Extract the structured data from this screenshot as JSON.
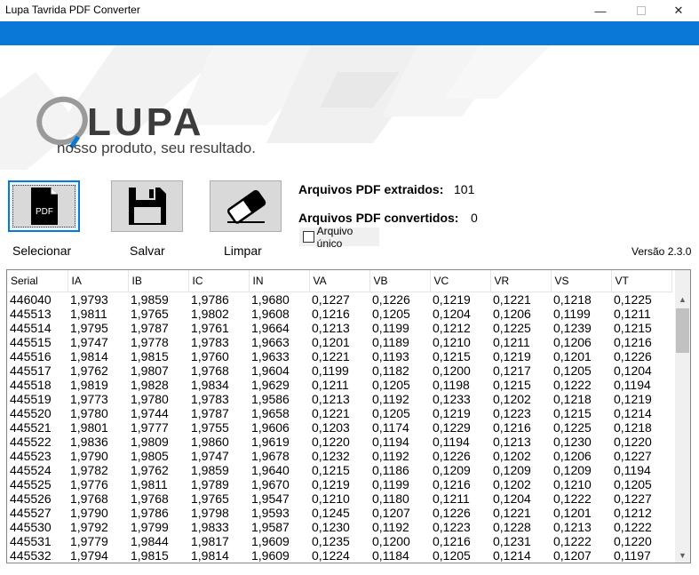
{
  "window": {
    "title": "Lupa Tavrida PDF Converter",
    "minimize_glyph": "—",
    "close_glyph": "✕"
  },
  "banner": {
    "logo_text": "LUPA",
    "tagline": "nosso produto, seu resultado."
  },
  "toolbar": {
    "pdf_icon_text": "PDF",
    "select_label": "Selecionar",
    "save_label": "Salvar",
    "clear_label": "Limpar"
  },
  "stats": {
    "extracted_label": "Arquivos PDF extraidos:",
    "extracted_value": "101",
    "converted_label": "Arquivos PDF convertidos:",
    "converted_value": "0"
  },
  "single_file": {
    "label": "Arquivo único",
    "checked": false
  },
  "version": "Versão 2.3.0",
  "table": {
    "columns": [
      "Serial",
      "IA",
      "IB",
      "IC",
      "IN",
      "VA",
      "VB",
      "VC",
      "VR",
      "VS",
      "VT"
    ],
    "rows": [
      [
        "446040",
        "1,9793",
        "1,9859",
        "1,9786",
        "1,9680",
        "0,1227",
        "0,1226",
        "0,1219",
        "0,1221",
        "0,1218",
        "0,1225"
      ],
      [
        "445513",
        "1,9811",
        "1,9765",
        "1,9802",
        "1,9608",
        "0,1216",
        "0,1205",
        "0,1204",
        "0,1206",
        "0,1199",
        "0,1211"
      ],
      [
        "445514",
        "1,9795",
        "1,9787",
        "1,9761",
        "1,9664",
        "0,1213",
        "0,1199",
        "0,1212",
        "0,1225",
        "0,1239",
        "0,1215"
      ],
      [
        "445515",
        "1,9747",
        "1,9778",
        "1,9783",
        "1,9663",
        "0,1201",
        "0,1189",
        "0,1210",
        "0,1211",
        "0,1206",
        "0,1216"
      ],
      [
        "445516",
        "1,9814",
        "1,9815",
        "1,9760",
        "1,9633",
        "0,1221",
        "0,1193",
        "0,1215",
        "0,1219",
        "0,1201",
        "0,1226"
      ],
      [
        "445517",
        "1,9762",
        "1,9807",
        "1,9768",
        "1,9604",
        "0,1199",
        "0,1182",
        "0,1200",
        "0,1217",
        "0,1205",
        "0,1204"
      ],
      [
        "445518",
        "1,9819",
        "1,9828",
        "1,9834",
        "1,9629",
        "0,1211",
        "0,1205",
        "0,1198",
        "0,1215",
        "0,1222",
        "0,1194"
      ],
      [
        "445519",
        "1,9773",
        "1,9780",
        "1,9783",
        "1,9586",
        "0,1213",
        "0,1192",
        "0,1233",
        "0,1202",
        "0,1218",
        "0,1219"
      ],
      [
        "445520",
        "1,9780",
        "1,9744",
        "1,9787",
        "1,9658",
        "0,1221",
        "0,1205",
        "0,1219",
        "0,1223",
        "0,1215",
        "0,1214"
      ],
      [
        "445521",
        "1,9801",
        "1,9777",
        "1,9755",
        "1,9606",
        "0,1203",
        "0,1174",
        "0,1229",
        "0,1216",
        "0,1225",
        "0,1218"
      ],
      [
        "445522",
        "1,9836",
        "1,9809",
        "1,9860",
        "1,9619",
        "0,1220",
        "0,1194",
        "0,1194",
        "0,1213",
        "0,1230",
        "0,1220"
      ],
      [
        "445523",
        "1,9790",
        "1,9805",
        "1,9747",
        "1,9678",
        "0,1232",
        "0,1192",
        "0,1226",
        "0,1202",
        "0,1206",
        "0,1227"
      ],
      [
        "445524",
        "1,9782",
        "1,9762",
        "1,9859",
        "1,9640",
        "0,1215",
        "0,1186",
        "0,1209",
        "0,1209",
        "0,1209",
        "0,1194"
      ],
      [
        "445525",
        "1,9776",
        "1,9811",
        "1,9789",
        "1,9670",
        "0,1219",
        "0,1199",
        "0,1216",
        "0,1202",
        "0,1210",
        "0,1205"
      ],
      [
        "445526",
        "1,9768",
        "1,9768",
        "1,9765",
        "1,9547",
        "0,1210",
        "0,1180",
        "0,1211",
        "0,1204",
        "0,1222",
        "0,1227"
      ],
      [
        "445527",
        "1,9790",
        "1,9786",
        "1,9798",
        "1,9593",
        "0,1245",
        "0,1207",
        "0,1226",
        "0,1221",
        "0,1201",
        "0,1212"
      ],
      [
        "445530",
        "1,9792",
        "1,9799",
        "1,9833",
        "1,9587",
        "0,1230",
        "0,1192",
        "0,1223",
        "0,1228",
        "0,1213",
        "0,1222"
      ],
      [
        "445531",
        "1,9779",
        "1,9844",
        "1,9817",
        "1,9609",
        "0,1235",
        "0,1200",
        "0,1216",
        "0,1231",
        "0,1222",
        "0,1220"
      ],
      [
        "445532",
        "1,9794",
        "1,9815",
        "1,9814",
        "1,9609",
        "0,1224",
        "0,1184",
        "0,1205",
        "0,1214",
        "0,1207",
        "0,1197"
      ]
    ]
  },
  "scrollbar": {
    "up_glyph": "▲",
    "down_glyph": "▼"
  },
  "colors": {
    "accent": "#0a78d7",
    "logo_gray": "#3c3c3c",
    "logo_blue": "#0a78d7"
  }
}
